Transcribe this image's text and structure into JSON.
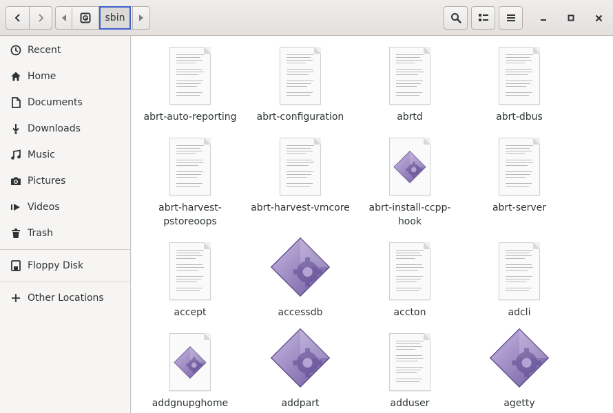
{
  "header": {
    "path_current": "sbin",
    "nav_back": "chevron-left-icon",
    "nav_forward": "chevron-right-icon",
    "path_prev": "triangle-left-icon",
    "path_root": "drive-icon",
    "path_next": "triangle-right-icon",
    "search": "search-icon",
    "view_toggle": "list-view-icon",
    "menu": "hamburger-menu-icon",
    "minimize": "minimize-icon",
    "maximize": "maximize-icon",
    "close": "close-icon"
  },
  "sidebar": {
    "items": [
      {
        "label": "Recent",
        "icon": "clock-icon"
      },
      {
        "label": "Home",
        "icon": "home-icon"
      },
      {
        "label": "Documents",
        "icon": "document-icon"
      },
      {
        "label": "Downloads",
        "icon": "download-icon"
      },
      {
        "label": "Music",
        "icon": "music-icon"
      },
      {
        "label": "Pictures",
        "icon": "camera-icon"
      },
      {
        "label": "Videos",
        "icon": "video-icon"
      },
      {
        "label": "Trash",
        "icon": "trash-icon"
      }
    ],
    "devices": [
      {
        "label": "Floppy Disk",
        "icon": "floppy-icon"
      }
    ],
    "other": {
      "label": "Other Locations",
      "icon": "plus-icon"
    }
  },
  "files": [
    {
      "name": "abrt-auto-reporting",
      "type": "text"
    },
    {
      "name": "abrt-configuration",
      "type": "text"
    },
    {
      "name": "abrtd",
      "type": "text"
    },
    {
      "name": "abrt-dbus",
      "type": "text"
    },
    {
      "name": "abrt-harvest-pstoreoops",
      "type": "text"
    },
    {
      "name": "abrt-harvest-vmcore",
      "type": "text"
    },
    {
      "name": "abrt-install-ccpp-hook",
      "type": "script"
    },
    {
      "name": "abrt-server",
      "type": "text"
    },
    {
      "name": "accept",
      "type": "text"
    },
    {
      "name": "accessdb",
      "type": "executable"
    },
    {
      "name": "accton",
      "type": "text"
    },
    {
      "name": "adcli",
      "type": "text"
    },
    {
      "name": "addgnupghome",
      "type": "script"
    },
    {
      "name": "addpart",
      "type": "executable"
    },
    {
      "name": "adduser",
      "type": "text"
    },
    {
      "name": "agetty",
      "type": "executable"
    }
  ],
  "colors": {
    "accent_focus": "#3f5fd0",
    "executable_light": "#b7a3d6",
    "executable_dark": "#6f5aa0"
  }
}
